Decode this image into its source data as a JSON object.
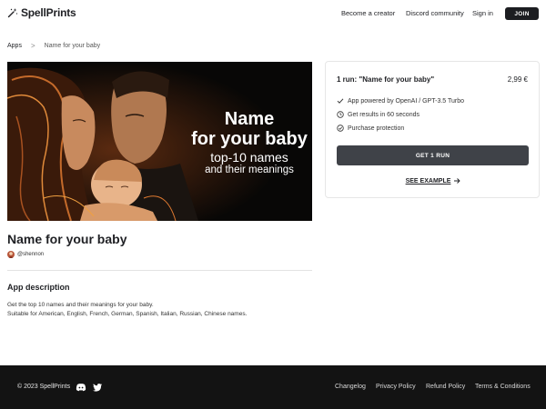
{
  "header": {
    "logo_text": "SpellPrints",
    "nav": [
      "Become a creator",
      "Discord community",
      "Sign in"
    ],
    "join_label": "JOIN"
  },
  "breadcrumb": {
    "root": "Apps",
    "separator": ">",
    "current": "Name for your baby"
  },
  "hero": {
    "line1": "Name",
    "line2": "for your baby",
    "line3": "top-10 names",
    "line4": "and their meanings"
  },
  "app": {
    "title": "Name for your baby",
    "author": "@shennon",
    "desc_heading": "App description",
    "desc_line1": "Get the top 10 names and their meanings for your baby.",
    "desc_line2": "Suitable for American, English, French, German, Spanish, Italian, Russian, Chinese names."
  },
  "card": {
    "title": "1 run: \"Name for your baby\"",
    "price": "2,99 €",
    "features": [
      "App powered by OpenAI / GPT-3.5 Turbo",
      "Get results in 60 seconds",
      "Purchase protection"
    ],
    "button_label": "GET 1 RUN",
    "see_example": "SEE EXAMPLE"
  },
  "footer": {
    "copyright": "© 2023 SpellPrints",
    "links": [
      "Changelog",
      "Privacy Policy",
      "Refund Policy",
      "Terms & Conditions"
    ]
  },
  "colors": {
    "footer_bg": "#131313",
    "button_dark": "#3f4248",
    "join_bg": "#1c1d21"
  }
}
